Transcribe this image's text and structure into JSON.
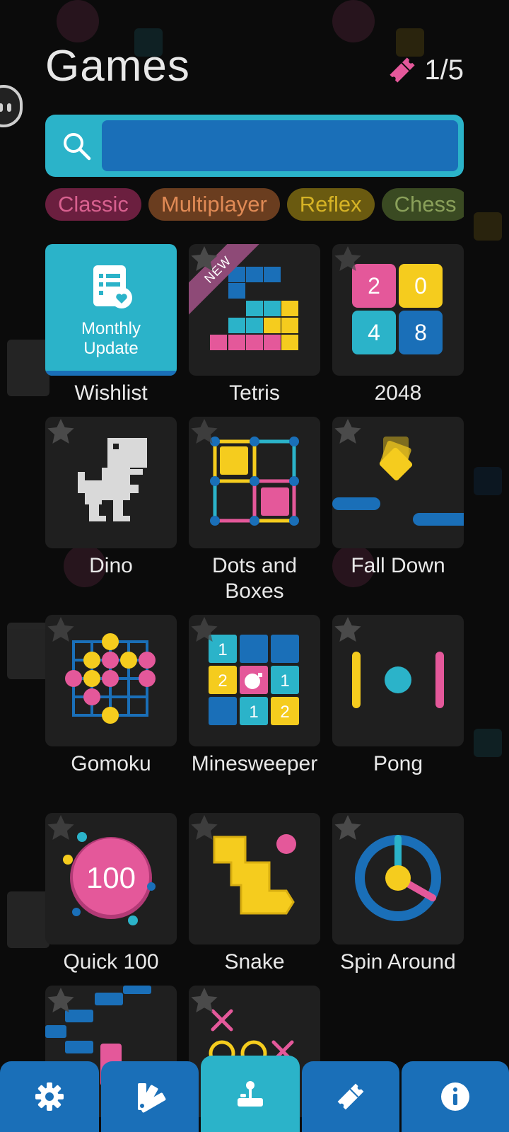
{
  "header": {
    "title": "Games",
    "tickets": "1/5"
  },
  "search": {
    "placeholder": ""
  },
  "categories": [
    {
      "label": "Classic",
      "bg": "#6b1f3f",
      "fg": "#d8608f"
    },
    {
      "label": "Multiplayer",
      "bg": "#6a3d1f",
      "fg": "#e08a55"
    },
    {
      "label": "Reflex",
      "bg": "#6a5a10",
      "fg": "#d6b325"
    },
    {
      "label": "Chess",
      "bg": "#3a4a22",
      "fg": "#8aa05a"
    }
  ],
  "wishlist": {
    "label": "Wishlist",
    "line1": "Monthly",
    "line2": "Update"
  },
  "games": [
    {
      "label": "Tetris",
      "badge": "NEW"
    },
    {
      "label": "2048"
    },
    {
      "label": "Dino"
    },
    {
      "label": "Dots and Boxes"
    },
    {
      "label": "Fall Down"
    },
    {
      "label": "Gomoku"
    },
    {
      "label": "Minesweeper"
    },
    {
      "label": "Pong"
    },
    {
      "label": "Quick 100"
    },
    {
      "label": "Snake"
    },
    {
      "label": "Spin Around"
    }
  ],
  "tiles_2048": [
    "2",
    "0",
    "4",
    "8"
  ],
  "minesweeper_numbers": [
    "1",
    "2",
    "1",
    "1",
    "2"
  ],
  "quick100_value": "100",
  "tabbar": [
    {
      "icon": "gear-icon"
    },
    {
      "icon": "palette-icon"
    },
    {
      "icon": "joystick-icon",
      "active": true
    },
    {
      "icon": "ticket-icon"
    },
    {
      "icon": "info-icon"
    }
  ],
  "colors": {
    "accent": "#2bb3c9",
    "blue": "#1a6fb8",
    "pink": "#e4589a",
    "yellow": "#f5cc1e",
    "tile": "#1f1f1f"
  }
}
